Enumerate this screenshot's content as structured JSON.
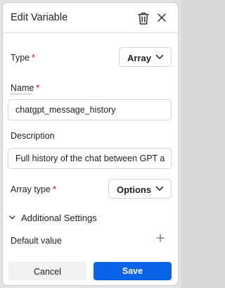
{
  "dialog": {
    "title": "Edit Variable"
  },
  "icons": {
    "trash": "trash-icon",
    "close": "close-icon",
    "chevron": "chevron-down-icon",
    "plus": "plus-icon"
  },
  "fields": {
    "type": {
      "label": "Type",
      "required_mark": "*",
      "value": "Array"
    },
    "name": {
      "label": "Name",
      "required_mark": "*",
      "value": "chatgpt_message_history"
    },
    "description": {
      "label": "Description",
      "value": "Full history of the chat between GPT a"
    },
    "array_type": {
      "label": "Array type",
      "required_mark": "*",
      "value": "Options"
    }
  },
  "additional_settings": {
    "label": "Additional Settings",
    "default_value_label": "Default value"
  },
  "footer": {
    "cancel_label": "Cancel",
    "save_label": "Save"
  },
  "colors": {
    "primary": "#0a63e6",
    "required": "#d0021b"
  }
}
